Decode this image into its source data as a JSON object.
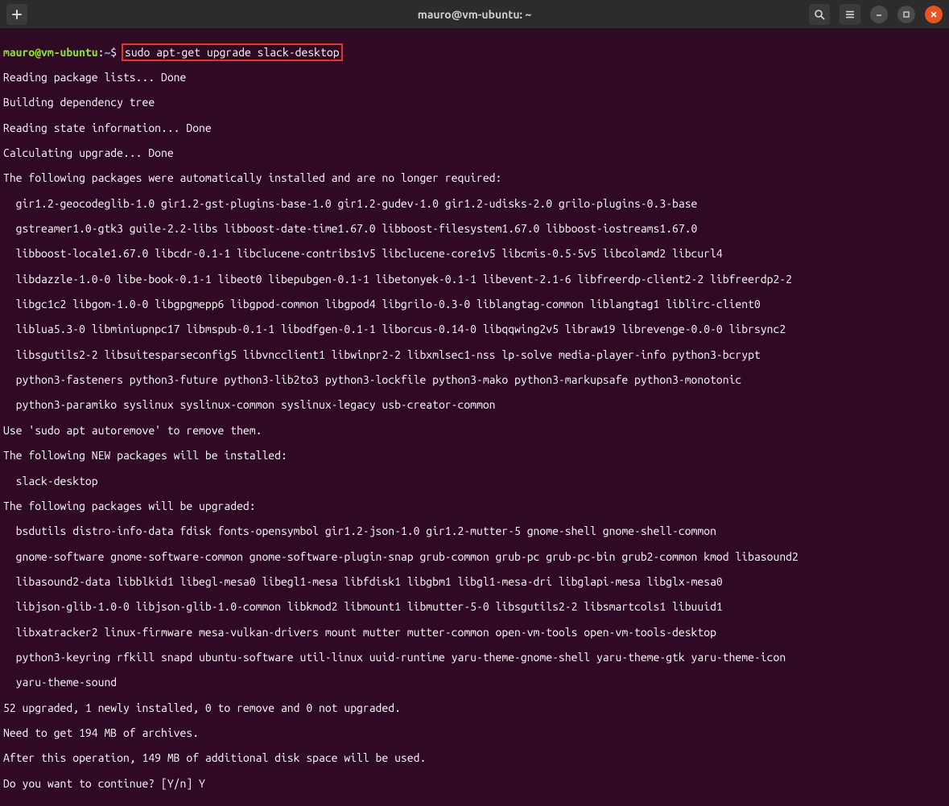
{
  "titlebar": {
    "title": "mauro@vm-ubuntu: ~",
    "add_tab_icon": "＋",
    "search_icon": "search",
    "menu_icon": "menu",
    "minimize_icon": "—",
    "maximize_icon": "□",
    "close_icon": "✕"
  },
  "prompt": {
    "user": "mauro@vm-ubuntu",
    "colon": ":",
    "path": "~",
    "symbol": "$"
  },
  "command": "sudo apt-get upgrade slack-desktop",
  "lines": {
    "l1": "Reading package lists... Done",
    "l2": "Building dependency tree",
    "l3": "Reading state information... Done",
    "l4": "Calculating upgrade... Done",
    "l5": "The following packages were automatically installed and are no longer required:",
    "l6": "  gir1.2-geocodeglib-1.0 gir1.2-gst-plugins-base-1.0 gir1.2-gudev-1.0 gir1.2-udisks-2.0 grilo-plugins-0.3-base",
    "l7": "  gstreamer1.0-gtk3 guile-2.2-libs libboost-date-time1.67.0 libboost-filesystem1.67.0 libboost-iostreams1.67.0",
    "l8": "  libboost-locale1.67.0 libcdr-0.1-1 libclucene-contribs1v5 libclucene-core1v5 libcmis-0.5-5v5 libcolamd2 libcurl4",
    "l9": "  libdazzle-1.0-0 libe-book-0.1-1 libeot0 libepubgen-0.1-1 libetonyek-0.1-1 libevent-2.1-6 libfreerdp-client2-2 libfreerdp2-2",
    "l10": "  libgc1c2 libgom-1.0-0 libgpgmepp6 libgpod-common libgpod4 libgrilo-0.3-0 liblangtag-common liblangtag1 liblirc-client0",
    "l11": "  liblua5.3-0 libminiupnpc17 libmspub-0.1-1 libodfgen-0.1-1 liborcus-0.14-0 libqqwing2v5 libraw19 librevenge-0.0-0 librsync2",
    "l12": "  libsgutils2-2 libsuitesparseconfig5 libvncclient1 libwinpr2-2 libxmlsec1-nss lp-solve media-player-info python3-bcrypt",
    "l13": "  python3-fasteners python3-future python3-lib2to3 python3-lockfile python3-mako python3-markupsafe python3-monotonic",
    "l14": "  python3-paramiko syslinux syslinux-common syslinux-legacy usb-creator-common",
    "l15": "Use 'sudo apt autoremove' to remove them.",
    "l16": "The following NEW packages will be installed:",
    "l17": "  slack-desktop",
    "l18": "The following packages will be upgraded:",
    "l19": "  bsdutils distro-info-data fdisk fonts-opensymbol gir1.2-json-1.0 gir1.2-mutter-5 gnome-shell gnome-shell-common",
    "l20": "  gnome-software gnome-software-common gnome-software-plugin-snap grub-common grub-pc grub-pc-bin grub2-common kmod libasound2",
    "l21": "  libasound2-data libblkid1 libegl-mesa0 libegl1-mesa libfdisk1 libgbm1 libgl1-mesa-dri libglapi-mesa libglx-mesa0",
    "l22": "  libjson-glib-1.0-0 libjson-glib-1.0-common libkmod2 libmount1 libmutter-5-0 libsgutils2-2 libsmartcols1 libuuid1",
    "l23": "  libxatracker2 linux-firmware mesa-vulkan-drivers mount mutter mutter-common open-vm-tools open-vm-tools-desktop",
    "l24": "  python3-keyring rfkill snapd ubuntu-software util-linux uuid-runtime yaru-theme-gnome-shell yaru-theme-gtk yaru-theme-icon",
    "l25": "  yaru-theme-sound",
    "l26": "52 upgraded, 1 newly installed, 0 to remove and 0 not upgraded.",
    "l27": "Need to get 194 MB of archives.",
    "l28": "After this operation, 149 MB of additional disk space will be used.",
    "l29": "Do you want to continue? [Y/n] Y"
  }
}
